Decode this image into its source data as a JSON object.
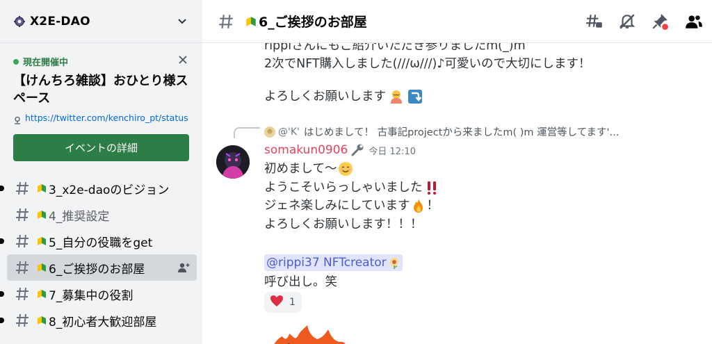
{
  "server": {
    "name": "X2E-DAO"
  },
  "event": {
    "status": "現在開催中",
    "title": "【けんちろ雑談】おひとり様スペース",
    "link": "https://twitter.com/kenchiro_pt/status",
    "button_label": "イベントの詳細"
  },
  "channels": [
    {
      "name": "3_x2e-daoのビジョン",
      "unread": true,
      "active": false
    },
    {
      "name": "4_推奨設定",
      "unread": false,
      "active": false
    },
    {
      "name": "5_自分の役職をget",
      "unread": true,
      "active": false
    },
    {
      "name": "6_ご挨拶のお部屋",
      "unread": false,
      "active": true
    },
    {
      "name": "7_募集中の役割",
      "unread": true,
      "active": false
    },
    {
      "name": "8_初心者大歓迎部屋",
      "unread": true,
      "active": false
    }
  ],
  "topbar": {
    "channel_name": "6_ご挨拶のお部屋"
  },
  "prev_message": {
    "lines": [
      "rippiさんにもご紹介いただき参りましたm(_)m",
      "2次でNFT購入しました(///ω///)♪可愛いので大切にします！",
      "",
      "よろしくお願いします"
    ]
  },
  "message": {
    "reply_author": "@'K'",
    "reply_text": "はじめまして！ 古事記projectから来ましたm( )m 運営等してます'...",
    "author": "somakun0906",
    "timestamp": "今日 12:10",
    "lines": [
      "初めまして〜",
      "ようこそいらっしゃいました",
      "ジェネ楽しみにしています",
      "よろしくお願いします！！！"
    ],
    "line3_suffix": "！",
    "mention": "@rippi37 NFTcreator",
    "callout": "呼び出し。笑",
    "reaction_count": "1"
  },
  "colors": {
    "sidebar_bg": "#f2f3f5",
    "accent_green": "#2d7d46",
    "author_red": "#e0455f",
    "mention_bg": "#e1e5fb",
    "link_blue": "#0068e0"
  }
}
